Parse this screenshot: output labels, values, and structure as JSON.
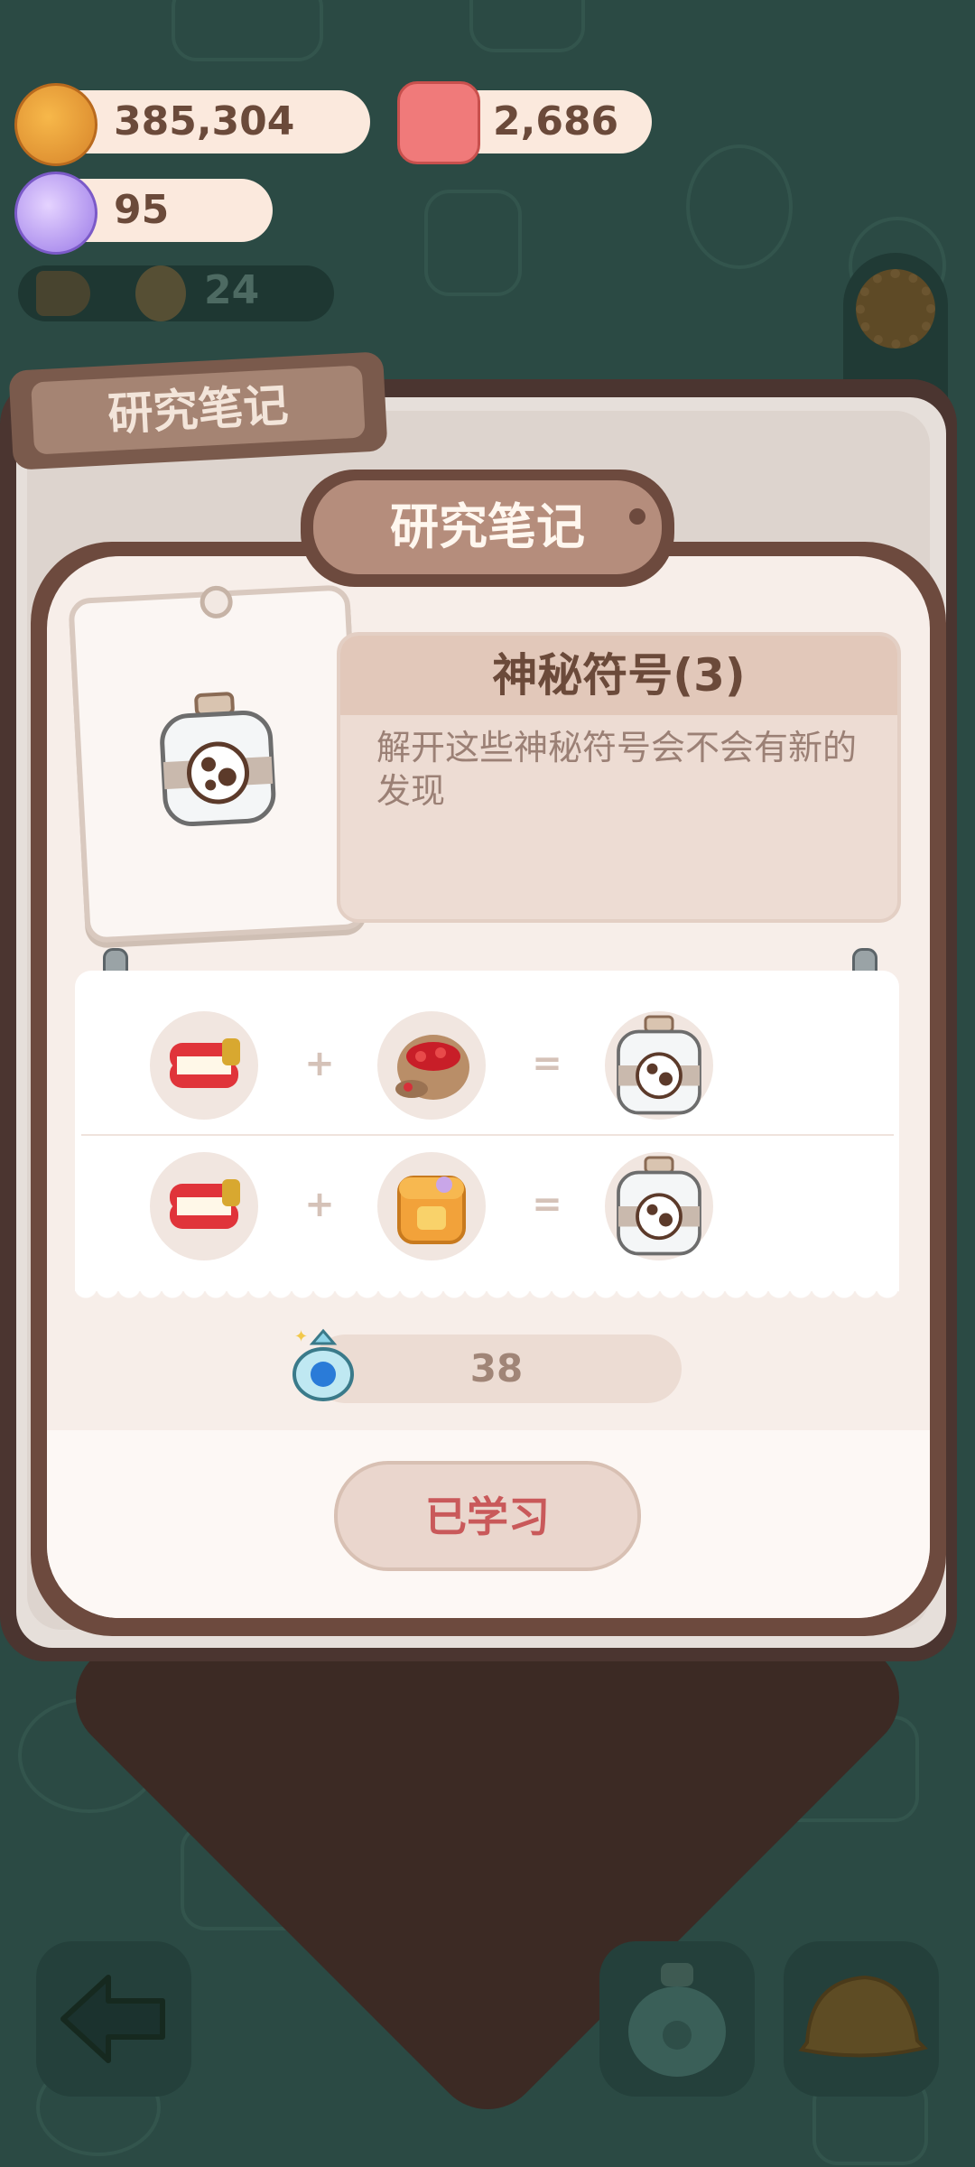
{
  "currencies": {
    "cookie": {
      "value": "385,304",
      "icon": "cookie-icon"
    },
    "candle": {
      "value": "2,686",
      "icon": "candle-icon"
    },
    "candy": {
      "value": "95",
      "icon": "candy-icon"
    }
  },
  "notice": {
    "count": "24"
  },
  "book": {
    "tab_label": "研究笔记",
    "title": "研究笔记"
  },
  "item": {
    "name": "神秘符号(3)",
    "description": "解开这些神秘符号会不会有新的发现"
  },
  "recipes": [
    {
      "left": "dentures-icon",
      "right": "red-beans-sack-icon",
      "result": "mystery-bottle-icon",
      "plus": "+",
      "equals": "="
    },
    {
      "left": "dentures-icon",
      "right": "orange-bag-icon",
      "result": "mystery-bottle-icon",
      "plus": "+",
      "equals": "="
    }
  ],
  "cost": {
    "value": "38",
    "icon": "blue-gem-pouch-icon"
  },
  "action": {
    "label": "已学习"
  },
  "colors": {
    "panel_border": "#6d4a3e",
    "button_text": "#c9595a",
    "background": "#2b4a44"
  }
}
